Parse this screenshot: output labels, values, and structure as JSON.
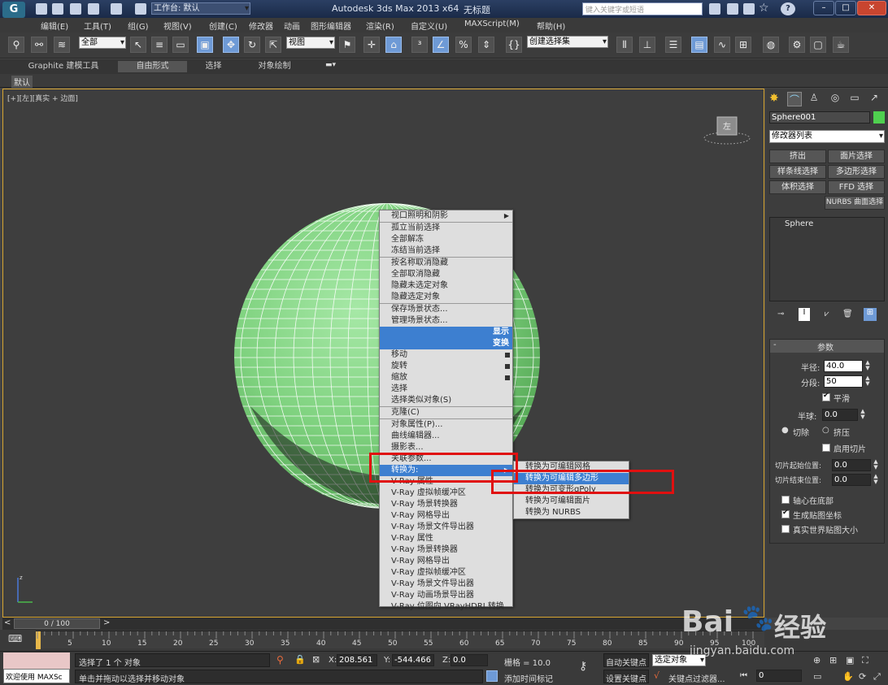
{
  "titlebar": {
    "workspace": "工作台: 默认",
    "app_title": "Autodesk 3ds Max  2013 x64",
    "doc_title": "无标题",
    "search_placeholder": "键入关键字或短语"
  },
  "menubar": [
    "编辑(E)",
    "工具(T)",
    "组(G)",
    "视图(V)",
    "创建(C)",
    "修改器",
    "动画",
    "图形编辑器",
    "渲染(R)",
    "自定义(U)",
    "MAXScript(M)",
    "帮助(H)"
  ],
  "toolbar": {
    "filter": "全部",
    "coord": "视图",
    "selection_set": "创建选择集"
  },
  "ribbon": {
    "tabs": [
      "Graphite 建模工具",
      "自由形式",
      "选择",
      "对象绘制"
    ],
    "sub": "默认"
  },
  "viewport": {
    "label": "[+][左][真实 + 边面]",
    "viewcube": "左"
  },
  "context_menu": {
    "items": [
      {
        "label": "视口照明和阴影",
        "arrow": true
      },
      {
        "label": "孤立当前选择",
        "sep": true
      },
      {
        "label": "全部解冻"
      },
      {
        "label": "冻结当前选择"
      },
      {
        "label": "按名称取消隐藏",
        "sep": true
      },
      {
        "label": "全部取消隐藏"
      },
      {
        "label": "隐藏未选定对象"
      },
      {
        "label": "隐藏选定对象"
      },
      {
        "label": "保存场景状态...",
        "sep": true
      },
      {
        "label": "管理场景状态..."
      },
      {
        "label": "显示",
        "header": true
      },
      {
        "label": "变换",
        "header": true
      },
      {
        "label": "移动",
        "sq": true
      },
      {
        "label": "旋转",
        "sq": true
      },
      {
        "label": "缩放",
        "sq": true
      },
      {
        "label": "选择"
      },
      {
        "label": "选择类似对象(S)"
      },
      {
        "label": "克隆(C)",
        "sep": true
      },
      {
        "label": "对象属性(P)...",
        "sep": true
      },
      {
        "label": "曲线编辑器..."
      },
      {
        "label": "摄影表..."
      },
      {
        "label": "关联参数..."
      },
      {
        "label": "转换为:",
        "arrow": true,
        "active": true
      },
      {
        "label": "V-Ray 属性"
      },
      {
        "label": "V-Ray 虚拟帧缓冲区"
      },
      {
        "label": "V-Ray 场景转换器"
      },
      {
        "label": "V-Ray 网格导出"
      },
      {
        "label": "V-Ray 场景文件导出器"
      },
      {
        "label": "V-Ray 属性"
      },
      {
        "label": "V-Ray 场景转换器"
      },
      {
        "label": "V-Ray 网格导出"
      },
      {
        "label": "V-Ray 虚拟帧缓冲区"
      },
      {
        "label": "V-Ray 场景文件导出器"
      },
      {
        "label": "V-Ray 动画场景导出器"
      },
      {
        "label": "V-Ray 位图向 VRayHDRI 转换"
      }
    ],
    "submenu": [
      {
        "label": "转换为可编辑网格"
      },
      {
        "label": "转换为可编辑多边形",
        "active": true
      },
      {
        "label": "转换为可变形gPoly"
      },
      {
        "label": "转换为可编辑面片"
      },
      {
        "label": "转换为 NURBS"
      }
    ]
  },
  "command_panel": {
    "object_name": "Sphere001",
    "modifier_list": "修改器列表",
    "buttons": [
      "挤出",
      "面片选择",
      "样条线选择",
      "多边形选择",
      "体积选择",
      "FFD 选择",
      "NURBS 曲面选择"
    ],
    "stack_item": "Sphere",
    "rollout_title": "参数",
    "radius_label": "半径:",
    "radius": "40.0",
    "segments_label": "分段:",
    "segments": "50",
    "smooth_label": "平滑",
    "hemisphere_label": "半球:",
    "hemisphere": "0.0",
    "chop_label": "切除",
    "squash_label": "挤压",
    "slice_on_label": "启用切片",
    "slice_from_label": "切片起始位置:",
    "slice_from": "0.0",
    "slice_to_label": "切片结束位置:",
    "slice_to": "0.0",
    "base_pivot_label": "轴心在底部",
    "gen_map_label": "生成贴图坐标",
    "real_world_label": "真实世界贴图大小"
  },
  "timeline": {
    "frame": "0 / 100",
    "ticks": [
      "5",
      "10",
      "15",
      "20",
      "25",
      "30",
      "35",
      "40",
      "45",
      "50",
      "55",
      "60",
      "65",
      "70",
      "75",
      "80",
      "85",
      "90",
      "95",
      "100"
    ]
  },
  "status": {
    "welcome": "欢迎使用 MAXSc",
    "selected": "选择了 1 个 对象",
    "prompt": "单击并拖动以选择并移动对象",
    "x_label": "X:",
    "x": "208.561",
    "y_label": "Y:",
    "y": "-544.466",
    "z_label": "Z:",
    "z": "0.0",
    "grid": "栅格 = 10.0",
    "add_time_tag": "添加时间标记",
    "auto_key": "自动关键点",
    "set_key": "设置关键点",
    "selected_obj": "选定对象",
    "key_filters": "关键点过滤器...",
    "frame_field": "0"
  },
  "watermark": {
    "brand": "Bai",
    "brand2": "经验",
    "url": "jingyan.baidu.com"
  },
  "colors": {
    "sphere": "#7fd27f",
    "highlight": "#3d7fd0",
    "redbox": "#e01010",
    "viewport_border": "#d7a531"
  }
}
